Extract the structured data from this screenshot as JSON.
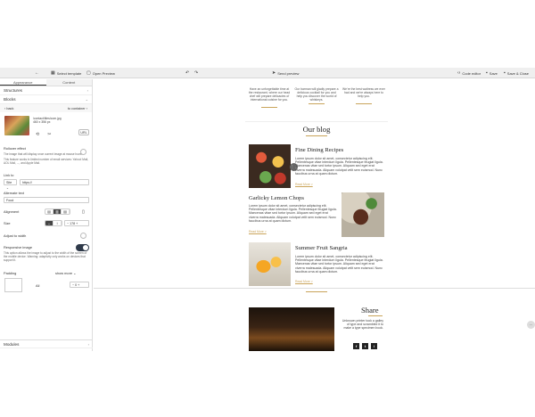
{
  "toolbar": {
    "back": "←",
    "select_template": "Select template",
    "open_preview": "Open Preview",
    "undo": "↶",
    "redo": "↷",
    "send_preview": "Send preview",
    "code_editor": "Code editor",
    "save": "Save",
    "save_close": "Save & Close"
  },
  "left": {
    "tabs": [
      "Appearance",
      "Content"
    ],
    "structures": "Structures",
    "blocks": "Blocks",
    "back": "back",
    "to_container": "to container",
    "image": {
      "path": "/contact/tiles/com.jpg",
      "dims": "460 x 356 px"
    },
    "url_button": "URL",
    "rollover": "Rollover effect",
    "rollover_help": "The image that will display once current image at mouse hover.",
    "alt_help": "This feature works in limited number of email services: Yahoo! Mail, AOL Mail, ..., and Apple Mail.",
    "link_to": "Link to",
    "link_type": "Site",
    "link_url": "https://",
    "alt_text_label": "Alternate text",
    "alt_text_value": "Food",
    "alignment": "Alignment",
    "size": "Size",
    "size_value": "178",
    "adjust_width": "Adjust to width",
    "responsive": "Responsive image",
    "responsive_help": "This option allows the image to adjust to the width of the screen of the mobile device. Warning: adaptivity only works on devices that support it.",
    "padding": "Padding",
    "show_more": "show more",
    "padding_all": "All",
    "padding_value": "0",
    "modules": "Modules"
  },
  "email": {
    "features": [
      "Have an unforgettable time at the restaurant, where our head chef will prepare delicacies of international cuisine for you.",
      "Our barman will gladly prepare a delicious cocktail for you and help you discover the world of whiskeys.",
      "We're the best waitress we ever had and we're always here to help you."
    ],
    "blog_title": "Our blog",
    "posts": [
      {
        "title": "Fine Dining Recipes",
        "text": "Lorem ipsum dolor sit amet, consectetur adipiscing elit. Pellentesque vitae interdum ligula. Pellentesque feugiat ligula. Maecenas vitae sed tortor ipsum. Aliquam sed eget erat viverra malesuada. Aliquam volutpat velit sem euismod. Nunc faucibus urna at quam dictum.",
        "read_more": "Read More >"
      },
      {
        "title": "Garlicky Lemon Chops",
        "text": "Lorem ipsum dolor sit amet, consectetur adipiscing elit. Pellentesque vitae interdum ligula. Pellentesque feugiat ligula. Maecenas vitae sed tortor ipsum. Aliquam sed eget erat viverra malesuada. Aliquam volutpat velit sem euismod. Nunc faucibus urna at quam dictum.",
        "read_more": "Read More >"
      },
      {
        "title": "Summer Fruit Sangria",
        "text": "Lorem ipsum dolor sit amet, consectetur adipiscing elit. Pellentesque vitae interdum ligula. Pellentesque feugiat ligula. Maecenas vitae sed tortor ipsum. Aliquam sed eget erat viverra malesuada. Aliquam volutpat velit sem euismod. Nunc faucibus urna at quam dictum.",
        "read_more": "Read More >"
      }
    ],
    "share_title": "Share",
    "share_text": "Unknown printer took a galley of type and scrambled it to make a type specimen book.",
    "social": [
      "f",
      "t",
      "i"
    ]
  },
  "colors": {
    "accent_gold": "#c9a45a",
    "dark": "#2f3a4a"
  }
}
